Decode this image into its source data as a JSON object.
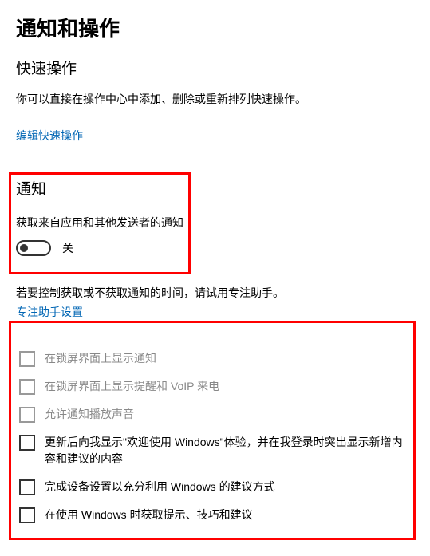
{
  "page_title": "通知和操作",
  "quick_actions": {
    "title": "快速操作",
    "description": "你可以直接在操作中心中添加、删除或重新排列快速操作。",
    "edit_link": "编辑快速操作"
  },
  "notifications": {
    "title": "通知",
    "get_from_apps_label": "获取来自应用和其他发送者的通知",
    "toggle_state_label": "关",
    "toggle_on": false,
    "focus_hint": "若要控制获取或不获取通知的时间，请试用专注助手。",
    "focus_link": "专注助手设置",
    "options": [
      {
        "label": "在锁屏界面上显示通知",
        "enabled": false,
        "checked": false
      },
      {
        "label": "在锁屏界面上显示提醒和 VoIP 来电",
        "enabled": false,
        "checked": false
      },
      {
        "label": "允许通知播放声音",
        "enabled": false,
        "checked": false
      },
      {
        "label": "更新后向我显示\"欢迎使用 Windows\"体验，并在我登录时突出显示新增内容和建议的内容",
        "enabled": true,
        "checked": false
      },
      {
        "label": "完成设备设置以充分利用 Windows 的建议方式",
        "enabled": true,
        "checked": false
      },
      {
        "label": "在使用 Windows 时获取提示、技巧和建议",
        "enabled": true,
        "checked": false
      }
    ]
  }
}
